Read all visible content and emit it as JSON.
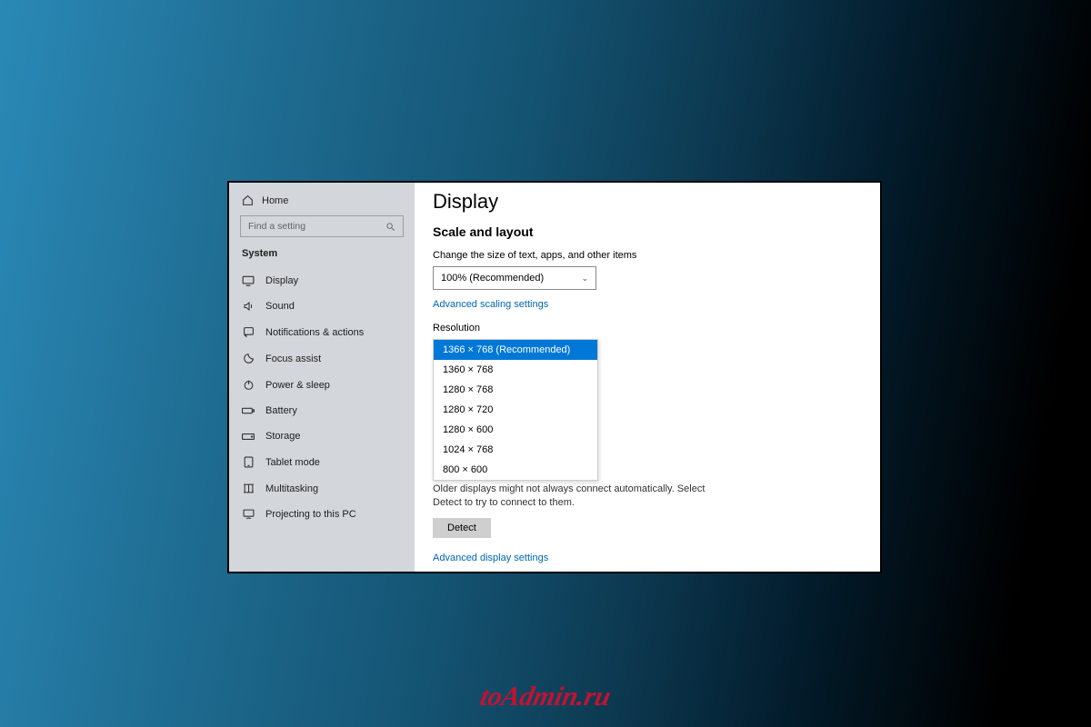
{
  "watermark": "toAdmin.ru",
  "sidebar": {
    "home_label": "Home",
    "search_placeholder": "Find a setting",
    "section_label": "System",
    "items": [
      {
        "icon": "display",
        "label": "Display"
      },
      {
        "icon": "sound",
        "label": "Sound"
      },
      {
        "icon": "notifications",
        "label": "Notifications & actions"
      },
      {
        "icon": "focus",
        "label": "Focus assist"
      },
      {
        "icon": "power",
        "label": "Power & sleep"
      },
      {
        "icon": "battery",
        "label": "Battery"
      },
      {
        "icon": "storage",
        "label": "Storage"
      },
      {
        "icon": "tablet",
        "label": "Tablet mode"
      },
      {
        "icon": "multitask",
        "label": "Multitasking"
      },
      {
        "icon": "projecting",
        "label": "Projecting to this PC"
      }
    ]
  },
  "main": {
    "title": "Display",
    "subtitle": "Scale and layout",
    "scale_label": "Change the size of text, apps, and other items",
    "scale_value": "100% (Recommended)",
    "advanced_scaling_link": "Advanced scaling settings",
    "resolution_label": "Resolution",
    "resolution_options": [
      "1366 × 768 (Recommended)",
      "1360 × 768",
      "1280 × 768",
      "1280 × 720",
      "1280 × 600",
      "1024 × 768",
      "800 × 600"
    ],
    "detect_hint": "Older displays might not always connect automatically. Select Detect to try to connect to them.",
    "detect_button": "Detect",
    "advanced_display_link": "Advanced display settings"
  }
}
